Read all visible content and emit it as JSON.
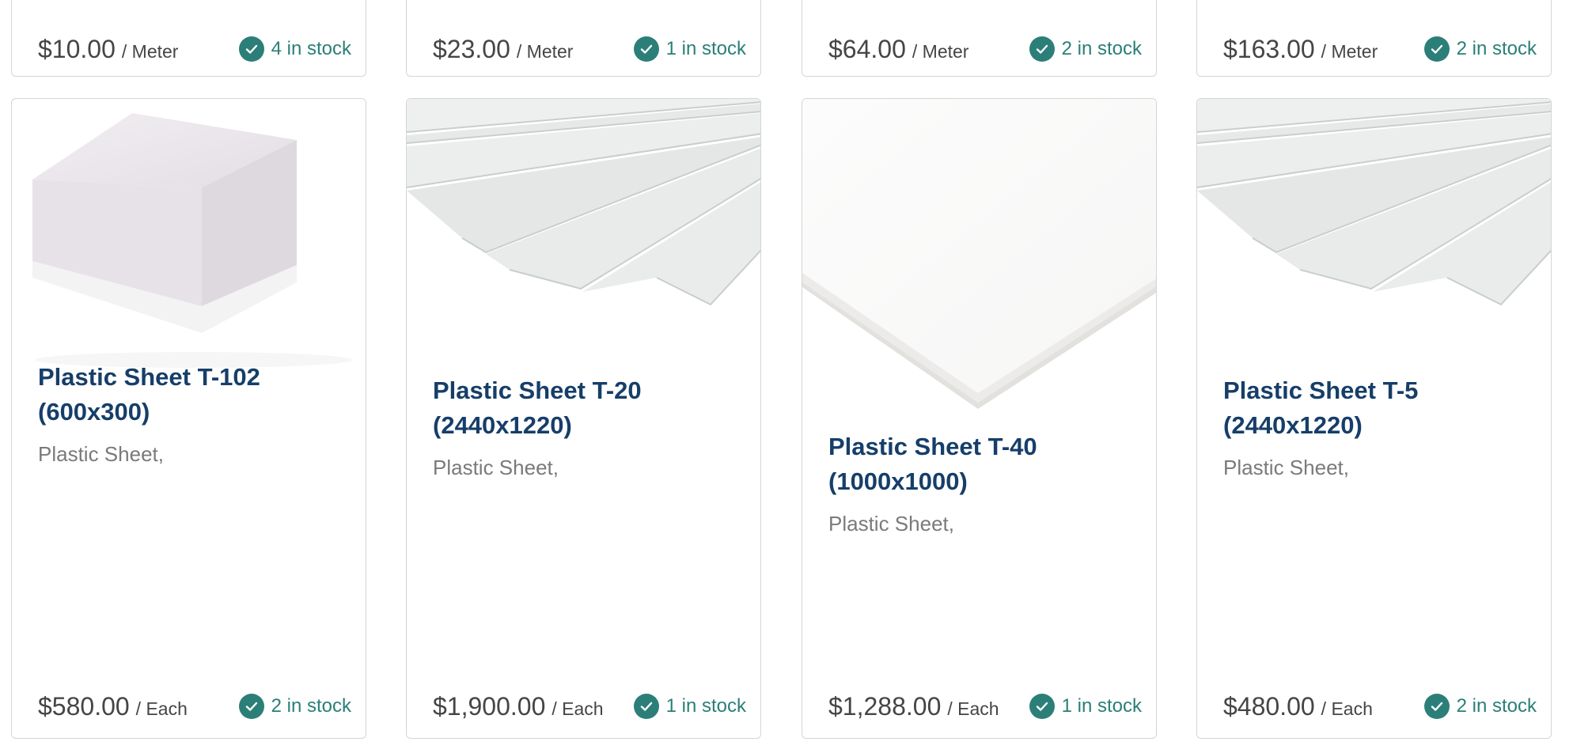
{
  "colors": {
    "title": "#163e69",
    "stock_green": "#2c7f78",
    "price": "#454545",
    "subtitle": "#7a7a7a",
    "border": "#d5d5d5"
  },
  "top_row": [
    {
      "price": "$10.00",
      "unit": "/ Meter",
      "stock": "4 in stock"
    },
    {
      "price": "$23.00",
      "unit": "/ Meter",
      "stock": "1 in stock"
    },
    {
      "price": "$64.00",
      "unit": "/ Meter",
      "stock": "2 in stock"
    },
    {
      "price": "$163.00",
      "unit": "/ Meter",
      "stock": "2 in stock"
    }
  ],
  "products": [
    {
      "title": "Plastic Sheet T-102 (600x300)",
      "subtitle": "Plastic Sheet,",
      "price": "$580.00",
      "unit": "/ Each",
      "stock": "2 in stock",
      "image": "plastic-block-image"
    },
    {
      "title": "Plastic Sheet T-20 (2440x1220)",
      "subtitle": "Plastic Sheet,",
      "price": "$1,900.00",
      "unit": "/ Each",
      "stock": "1 in stock",
      "image": "stacked-sheets-image"
    },
    {
      "title": "Plastic Sheet T-40 (1000x1000)",
      "subtitle": "Plastic Sheet,",
      "price": "$1,288.00",
      "unit": "/ Each",
      "stock": "1 in stock",
      "image": "single-sheet-corner-image"
    },
    {
      "title": "Plastic Sheet T-5 (2440x1220)",
      "subtitle": "Plastic Sheet,",
      "price": "$480.00",
      "unit": "/ Each",
      "stock": "2 in stock",
      "image": "stacked-sheets-image"
    }
  ]
}
